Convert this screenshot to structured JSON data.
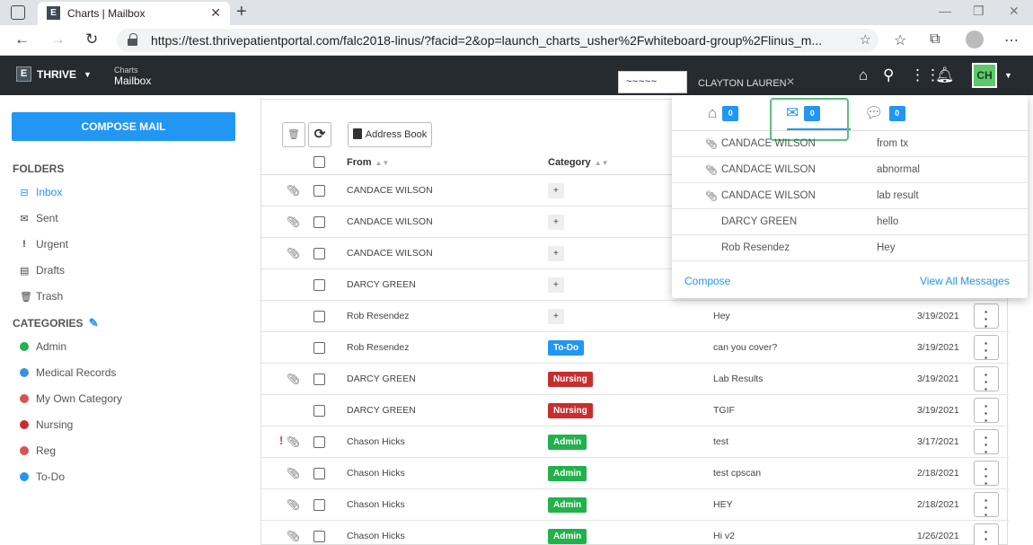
{
  "browser": {
    "tab_title": "Charts | Mailbox",
    "url": "https://test.thrivepatientportal.com/falc2018-linus/?facid=2&op=launch_charts_usher%2Fwhiteboard-group%2Flinus_m..."
  },
  "app": {
    "brand": "THRIVE",
    "breadcrumb_small": "Charts",
    "breadcrumb_big": "Mailbox",
    "patient_name": "CLAYTON LAUREN",
    "avatar_initials": "CH",
    "accent_color": "#2196f3"
  },
  "sidebar": {
    "compose_label": "COMPOSE MAIL",
    "folders_title": "FOLDERS",
    "folders": [
      {
        "label": "Inbox",
        "icon": "inbox-icon"
      },
      {
        "label": "Sent",
        "icon": "envelope-icon"
      },
      {
        "label": "Urgent",
        "icon": "exclamation-icon"
      },
      {
        "label": "Drafts",
        "icon": "document-icon"
      },
      {
        "label": "Trash",
        "icon": "trash-icon"
      }
    ],
    "categories_title": "CATEGORIES",
    "categories": [
      {
        "label": "Admin",
        "color": "#22b14c"
      },
      {
        "label": "Medical Records",
        "color": "#3d8fe0"
      },
      {
        "label": "My Own Category",
        "color": "#d9534f"
      },
      {
        "label": "Nursing",
        "color": "#c62f2f"
      },
      {
        "label": "Reg",
        "color": "#d9534f"
      },
      {
        "label": "To-Do",
        "color": "#2196f3"
      }
    ]
  },
  "toolbar": {
    "address_book_label": "Address Book"
  },
  "table": {
    "columns": {
      "from": "From",
      "category": "Category"
    },
    "rows": [
      {
        "from": "CANDACE WILSON",
        "category": "+",
        "subject": "",
        "date": ""
      },
      {
        "from": "CANDACE WILSON",
        "category": "+",
        "subject": "",
        "date": ""
      },
      {
        "from": "CANDACE WILSON",
        "category": "+",
        "subject": "",
        "date": ""
      },
      {
        "from": "DARCY GREEN",
        "category": "+",
        "subject": "",
        "date": ""
      },
      {
        "from": "Rob Resendez",
        "category": "+",
        "subject": "Hey",
        "date": "3/19/2021"
      },
      {
        "from": "Rob Resendez",
        "category": "To-Do",
        "subject": "can you cover?",
        "date": "3/19/2021"
      },
      {
        "from": "DARCY GREEN",
        "category": "Nursing",
        "subject": "Lab Results",
        "date": "3/19/2021"
      },
      {
        "from": "DARCY GREEN",
        "category": "Nursing",
        "subject": "TGIF",
        "date": "3/19/2021"
      },
      {
        "from": "Chason Hicks",
        "category": "Admin",
        "subject": "test",
        "date": "3/17/2021"
      },
      {
        "from": "Chason Hicks",
        "category": "Admin",
        "subject": "test cpscan",
        "date": "2/18/2021"
      },
      {
        "from": "Chason Hicks",
        "category": "Admin",
        "subject": "HEY",
        "date": "2/18/2021"
      },
      {
        "from": "Chason Hicks",
        "category": "Admin",
        "subject": "Hi v2",
        "date": "1/26/2021"
      }
    ]
  },
  "notifications": {
    "tabs": [
      {
        "icon": "inbox-tray-icon",
        "count": "0"
      },
      {
        "icon": "envelope-icon",
        "count": "0"
      },
      {
        "icon": "chat-bubble-icon",
        "count": "0"
      }
    ],
    "messages": [
      {
        "from": "CANDACE WILSON",
        "subject": "from tx"
      },
      {
        "from": "CANDACE WILSON",
        "subject": "abnormal"
      },
      {
        "from": "CANDACE WILSON",
        "subject": "lab result"
      },
      {
        "from": "DARCY GREEN",
        "subject": "hello"
      },
      {
        "from": "Rob Resendez",
        "subject": "Hey"
      }
    ],
    "compose_label": "Compose",
    "view_all_label": "View All Messages"
  }
}
